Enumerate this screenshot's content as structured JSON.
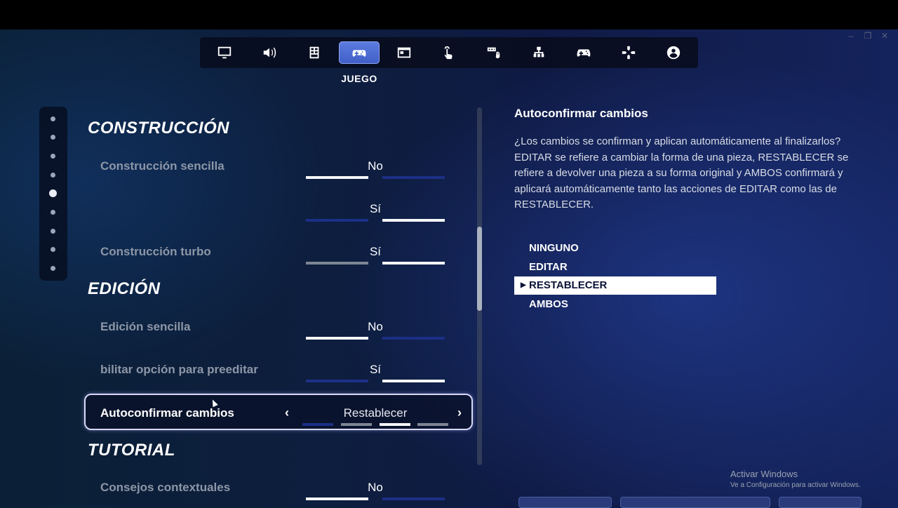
{
  "tabs": [
    {
      "icon": "monitor-icon"
    },
    {
      "icon": "speaker-icon"
    },
    {
      "icon": "grid-icon"
    },
    {
      "icon": "gamepad-settings-icon",
      "active": true,
      "caption": "JUEGO"
    },
    {
      "icon": "window-icon"
    },
    {
      "icon": "touch-icon"
    },
    {
      "icon": "keyboard-mouse-icon"
    },
    {
      "icon": "hierarchy-icon"
    },
    {
      "icon": "controller-icon"
    },
    {
      "icon": "dpad-icon"
    },
    {
      "icon": "account-icon"
    }
  ],
  "active_tab_caption": "JUEGO",
  "sections": {
    "construccion": "CONSTRUCCIÓN",
    "edicion": "EDICIÓN",
    "tutorial": "TUTORIAL"
  },
  "settings": {
    "construccion_sencilla": {
      "label": "Construcción sencilla",
      "value": "No"
    },
    "unlabeled": {
      "label": "",
      "value": "Sí"
    },
    "construccion_turbo": {
      "label": "Construcción turbo",
      "value": "Sí"
    },
    "edicion_sencilla": {
      "label": "Edición sencilla",
      "value": "No"
    },
    "preeditar": {
      "label": "bilitar opción para preeditar",
      "value": "Sí"
    },
    "autoconfirmar": {
      "label": "Autoconfirmar cambios",
      "value": "Restablecer"
    },
    "consejos": {
      "label": "Consejos contextuales",
      "value": "No"
    }
  },
  "detail": {
    "title": "Autoconfirmar cambios",
    "description": "¿Los cambios se confirman y aplican automáticamente al finalizarlos? EDITAR se refiere a cambiar la forma de una pieza, RESTABLECER se refiere a devolver una pieza a su forma original y AMBOS confirmará y aplicará automáticamente tanto las acciones de EDITAR como las de RESTABLECER.",
    "options": [
      "NINGUNO",
      "EDITAR",
      "RESTABLECER",
      "AMBOS"
    ],
    "selected": "RESTABLECER"
  },
  "watermark": {
    "line1": "Activar Windows",
    "line2": "Ve a Configuración para activar Windows."
  },
  "colors": {
    "accent": "#4a6ad6",
    "bar_on": "#f4f5f7",
    "bar_off": "#1c2f86"
  }
}
